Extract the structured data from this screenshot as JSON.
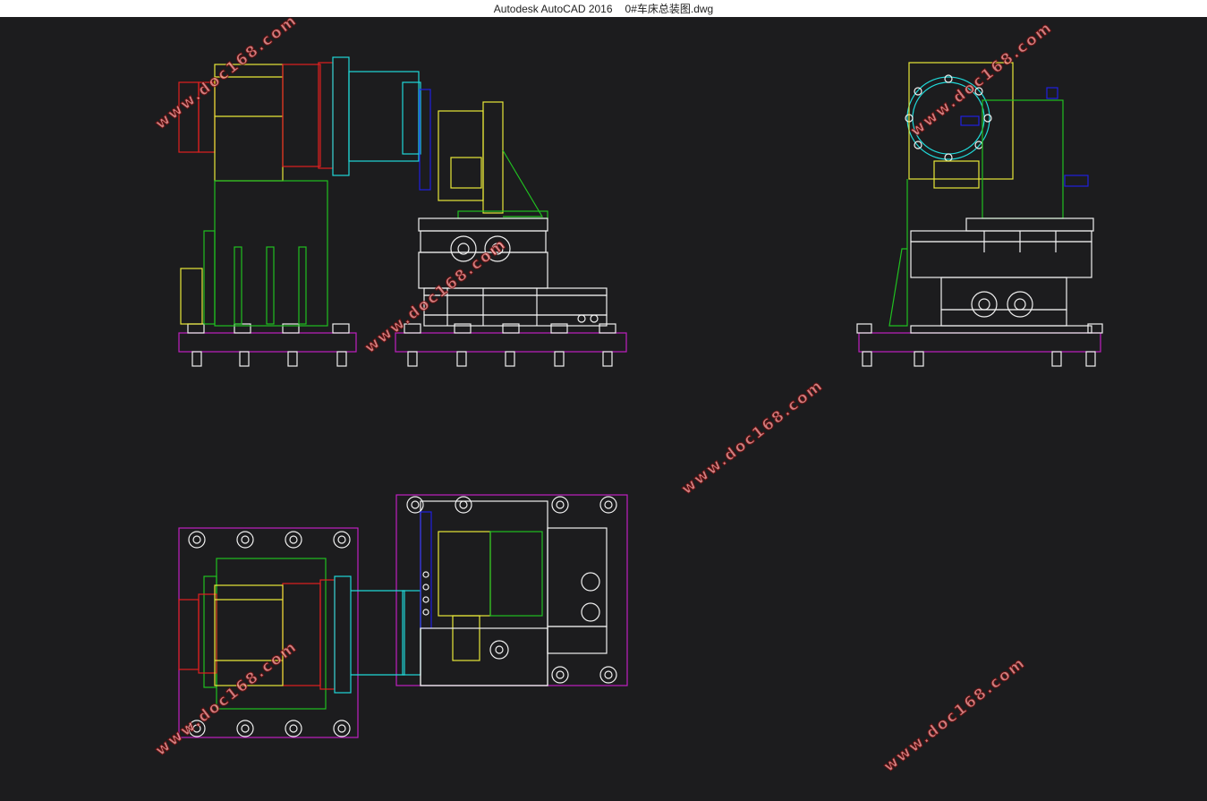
{
  "window": {
    "app_title": "Autodesk AutoCAD 2016",
    "file_name": "0#车床总装图.dwg"
  },
  "watermark": {
    "text": "www.doc168.com"
  },
  "colors": {
    "background": "#1c1c1e",
    "red": "#e02020",
    "yellow": "#e8e838",
    "green": "#20c020",
    "cyan": "#20d8d8",
    "blue": "#2020e0",
    "white": "#f0f0f0",
    "magenta": "#c020c0"
  },
  "views": [
    "front-view",
    "side-view",
    "top-view"
  ]
}
